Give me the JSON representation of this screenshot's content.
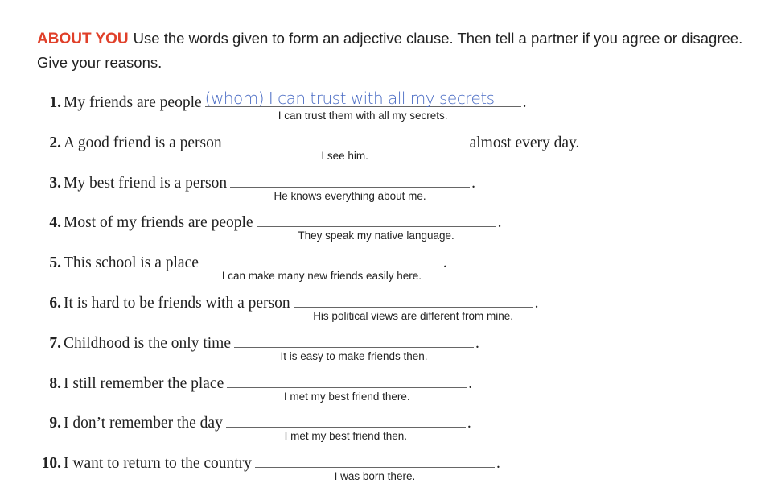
{
  "instructions": {
    "tag": "ABOUT YOU",
    "text": "Use the words given to form an adjective clause. Then tell a partner if you agree or disagree. Give your reasons."
  },
  "items": [
    {
      "num": "1.",
      "before": "My friends are people",
      "answer": "(whom) I can trust with all my secrets",
      "after": ".",
      "hint": "I can trust them with all my secrets."
    },
    {
      "num": "2.",
      "before": "A good friend is a person",
      "answer": "",
      "after": "almost every day.",
      "hint": "I see him."
    },
    {
      "num": "3.",
      "before": "My best friend is a person",
      "answer": "",
      "after": ".",
      "hint": "He knows everything about me."
    },
    {
      "num": "4.",
      "before": "Most of my friends are people",
      "answer": "",
      "after": ".",
      "hint": "They speak my native language."
    },
    {
      "num": "5.",
      "before": "This school is a place",
      "answer": "",
      "after": ".",
      "hint": "I can make many new friends easily here."
    },
    {
      "num": "6.",
      "before": "It is hard to be friends with a person",
      "answer": "",
      "after": ".",
      "hint": "His political views are different from mine."
    },
    {
      "num": "7.",
      "before": "Childhood is the only time",
      "answer": "",
      "after": ".",
      "hint": "It is easy to make friends then."
    },
    {
      "num": "8.",
      "before": "I still remember the place",
      "answer": "",
      "after": ".",
      "hint": "I met my best friend there."
    },
    {
      "num": "9.",
      "before": "I don’t remember the day",
      "answer": "",
      "after": ".",
      "hint": "I met my best friend then."
    },
    {
      "num": "10.",
      "before": "I want to return to the country",
      "answer": "",
      "after": ".",
      "hint": "I was born there."
    }
  ],
  "colors": {
    "tag": "#e0402a",
    "answer": "#4a6cc4"
  }
}
